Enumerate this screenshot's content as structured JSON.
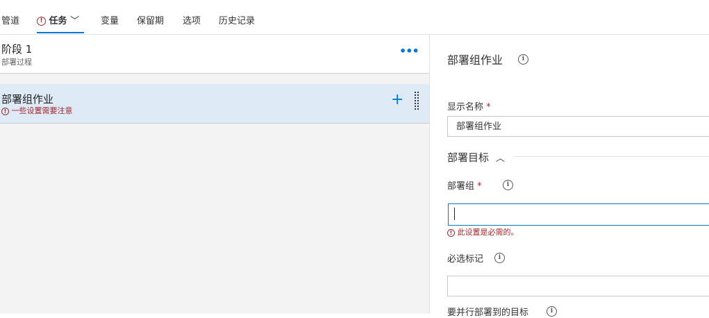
{
  "tabs": [
    {
      "label": "管道",
      "active": false
    },
    {
      "label": "任务",
      "active": true,
      "has_error": true
    },
    {
      "label": "变量",
      "active": false
    },
    {
      "label": "保留期",
      "active": false
    },
    {
      "label": "选项",
      "active": false
    },
    {
      "label": "历史记录",
      "active": false
    }
  ],
  "tab_error_icon": "!",
  "tab_chevron": "﹀",
  "stage": {
    "title": "阶段 1",
    "subtitle": "部署过程",
    "more_icon": "•••"
  },
  "job": {
    "title": "部署组作业",
    "warning": "一些设置需要注意",
    "error_icon": "!",
    "plus_icon": "+"
  },
  "details": {
    "title": "部署组作业",
    "info_icon": "i",
    "display_name": {
      "label": "显示名称",
      "required_mark": "*",
      "value": "部署组作业"
    },
    "section": {
      "title": "部署目标",
      "chevron": "︿"
    },
    "deployment_group": {
      "label": "部署组",
      "required_mark": "*",
      "value": "",
      "error": "此设置是必需的。"
    },
    "required_tags": {
      "label": "必选标记",
      "value": ""
    },
    "parallel_targets": {
      "label": "要并行部署到的目标"
    }
  },
  "colors": {
    "accent": "#0078d4",
    "error": "#a4262c",
    "selected_row": "#deebf7",
    "panel_bg": "#f3f3f3"
  }
}
